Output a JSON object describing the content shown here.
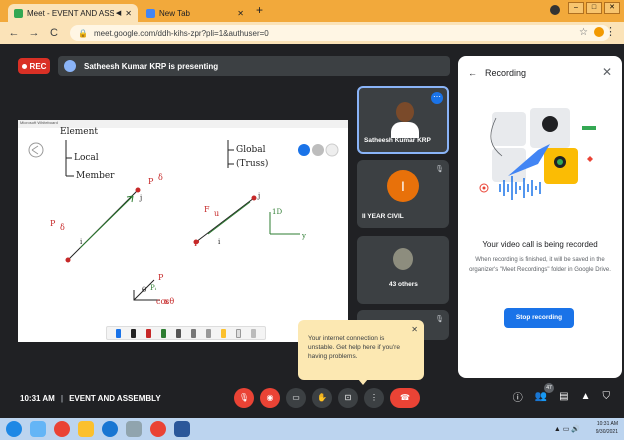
{
  "browser": {
    "tabs": [
      {
        "title": "Meet - EVENT AND ASSEMB",
        "active": true
      },
      {
        "title": "New Tab",
        "active": false
      }
    ],
    "url": "meet.google.com/ddh-kihs-zpr?pli=1&authuser=0"
  },
  "meeting": {
    "rec_label": "REC",
    "presenting_label": "Satheesh Kumar KRP is presenting",
    "time": "10:31 AM",
    "title": "EVENT AND ASSEMBLY",
    "participant_count": "47"
  },
  "participants": [
    {
      "name": "Satheesh Kumar KRP"
    },
    {
      "name": "II YEAR CIVIL",
      "initial": "I"
    },
    {
      "name": "43 others"
    }
  ],
  "whiteboard": {
    "window_title": "Microsoft Whiteboard",
    "strokes": [
      "Element",
      "Local",
      "Member",
      "Global",
      "(Truss)",
      "P",
      "δ",
      "P",
      "δ",
      "i",
      "j",
      "F",
      "u",
      "i",
      "j",
      "P",
      "θ",
      "Pᵢ",
      "P",
      "cosθ",
      "x",
      "y",
      "1D"
    ]
  },
  "panel": {
    "title": "Recording",
    "heading": "Your video call is being recorded",
    "description": "When recording is finished, it will be saved in the organizer's \"Meet Recordings\" folder in Google Drive.",
    "stop_button": "Stop recording"
  },
  "toast": {
    "message": "Your internet connection is unstable. Get help here if you're having problems."
  },
  "taskbar": {
    "time": "10:31 AM",
    "date": "9/30/2021"
  },
  "colors": {
    "accent": "#1a73e8",
    "danger": "#ea4335",
    "meet_bg": "#202124",
    "chrome_tab": "#f2a93b"
  }
}
